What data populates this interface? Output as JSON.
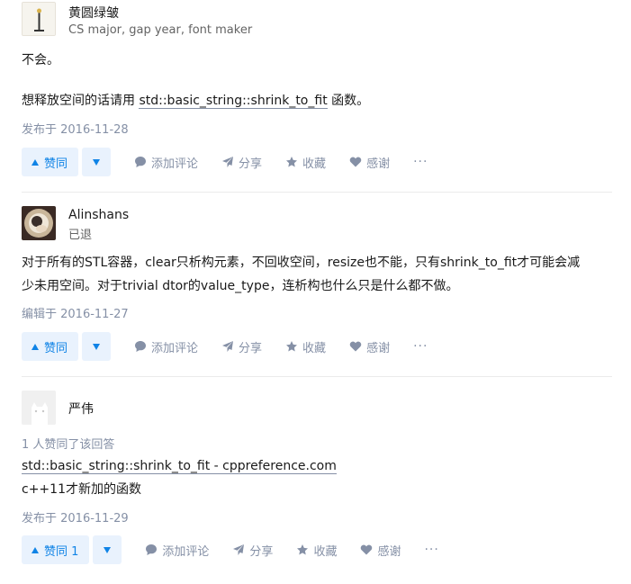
{
  "answers": [
    {
      "author": {
        "name": "黄圆绿皱",
        "bio": "CS major, gap year, font maker"
      },
      "content": {
        "line1": "不会。",
        "line2_prefix": "想释放空间的话请用 ",
        "line2_link": "std::basic_string::shrink_to_fit",
        "line2_suffix": " 函数。"
      },
      "meta": "发布于 2016-11-28",
      "actions": {
        "vote_up": "赞同",
        "comment": "添加评论",
        "share": "分享",
        "collect": "收藏",
        "thanks": "感谢",
        "more": "···"
      }
    },
    {
      "author": {
        "name": "Alinshans",
        "bio": "已退"
      },
      "content": {
        "line1": "对于所有的STL容器，clear只析构元素，不回收空间，resize也不能，只有shrink_to_fit才可能会减",
        "line2": "少未用空间。对于trivial dtor的value_type，连析构也什么只是什么都不做。"
      },
      "meta": "编辑于 2016-11-27",
      "actions": {
        "vote_up": "赞同",
        "comment": "添加评论",
        "share": "分享",
        "collect": "收藏",
        "thanks": "感谢",
        "more": "···"
      }
    },
    {
      "author": {
        "name": "严伟"
      },
      "voters": "1 人赞同了该回答",
      "content": {
        "link": "std::basic_string::shrink_to_fit - cppreference.com",
        "line2": "c++11才新加的函数"
      },
      "meta": "发布于 2016-11-29",
      "actions": {
        "vote_up": "赞同 1",
        "comment": "添加评论",
        "share": "分享",
        "collect": "收藏",
        "thanks": "感谢",
        "more": "···"
      }
    }
  ],
  "colors": {
    "accent": "#0f83e6",
    "accent_bg": "#e9f2fd",
    "muted": "#8590a6"
  },
  "icons": [
    "upvote-triangle-icon",
    "downvote-triangle-icon",
    "comment-bubble-icon",
    "paper-plane-icon",
    "star-icon",
    "heart-icon",
    "more-dots-icon"
  ]
}
